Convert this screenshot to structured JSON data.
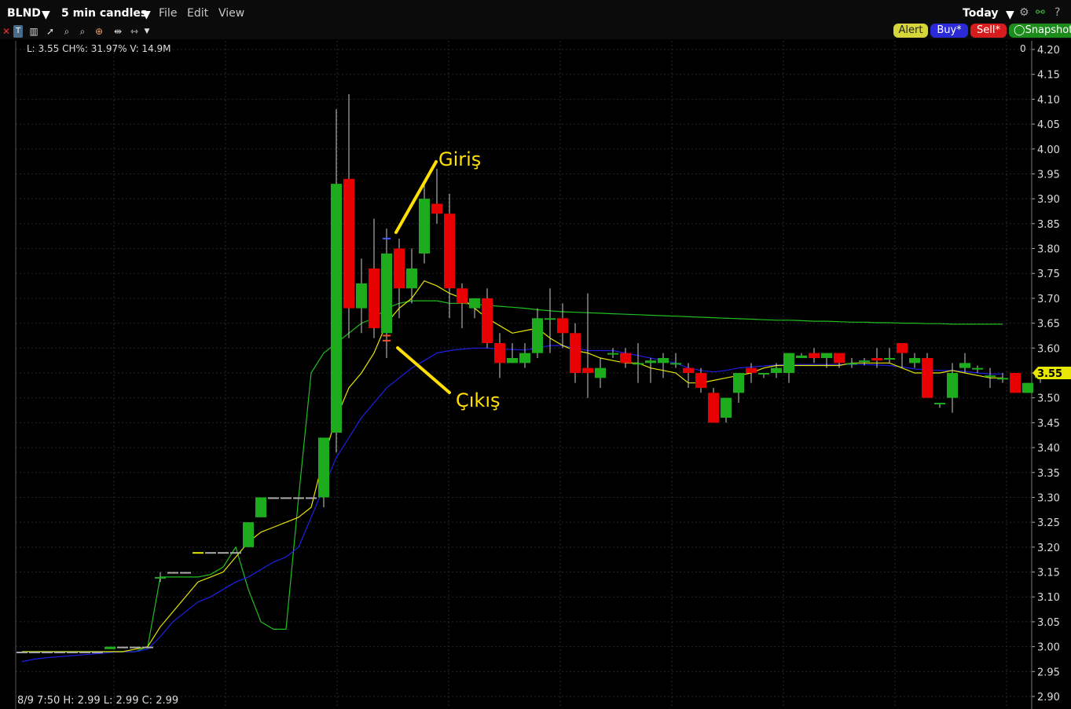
{
  "header": {
    "symbol": "BLND",
    "interval": "5 min candles",
    "menus": [
      "File",
      "Edit",
      "View"
    ],
    "period": "Today"
  },
  "toolbar": {
    "icons": [
      "close-icon",
      "bar-style-icon",
      "text-tool-icon",
      "candles-icon",
      "cursor-icon",
      "zoom-in-icon",
      "zoom-out-icon",
      "crosshair-icon",
      "pan-icon",
      "fit-icon",
      "more-icon"
    ],
    "alert_label": "Alert",
    "buy_label": "Buy*",
    "sell_label": "Sell*",
    "snapshot_label": "Snapshot"
  },
  "info_top": {
    "l": "L: 3.55",
    "ch": "CH%: 31.97%",
    "v": "V: 14.9M",
    "right_value": "0"
  },
  "info_bottom": {
    "date": "8/9 7:50",
    "h": "H: 2.99",
    "l": "L: 2.99",
    "c": "C: 2.99"
  },
  "colors": {
    "up": "#1cac1c",
    "down": "#e60000",
    "ma_fast": "#e6e600",
    "ma_mid": "#2020e6",
    "ma_slow": "#20c020",
    "annotation": "#ffe000",
    "price_tag": "#e6e600"
  },
  "chart_data": {
    "type": "candlestick",
    "y_ticks": [
      "4.20",
      "4.15",
      "4.10",
      "4.05",
      "4.00",
      "3.95",
      "3.90",
      "3.85",
      "3.80",
      "3.75",
      "3.70",
      "3.65",
      "3.60",
      "3.55",
      "3.50",
      "3.45",
      "3.40",
      "3.35",
      "3.30",
      "3.25",
      "3.20",
      "3.15",
      "3.10",
      "3.05",
      "3.00",
      "2.95",
      "2.90"
    ],
    "ylim": [
      2.9,
      4.2
    ],
    "last_price_label": "3.55",
    "candles": [
      {
        "o": 2.99,
        "h": 2.99,
        "l": 2.99,
        "c": 2.99
      },
      {
        "o": 2.99,
        "h": 2.99,
        "l": 2.99,
        "c": 2.99
      },
      {
        "o": 2.99,
        "h": 2.99,
        "l": 2.99,
        "c": 2.99
      },
      {
        "o": 2.99,
        "h": 2.99,
        "l": 2.99,
        "c": 2.99
      },
      {
        "o": 2.99,
        "h": 2.99,
        "l": 2.99,
        "c": 2.99
      },
      {
        "o": 2.99,
        "h": 2.99,
        "l": 2.99,
        "c": 2.99
      },
      {
        "o": 2.99,
        "h": 2.99,
        "l": 2.99,
        "c": 2.99
      },
      {
        "o": 2.995,
        "h": 3.0,
        "l": 2.995,
        "c": 3.0
      },
      {
        "o": 3.0,
        "h": 3.0,
        "l": 3.0,
        "c": 3.0
      },
      {
        "o": 3.0,
        "h": 3.0,
        "l": 3.0,
        "c": 3.0
      },
      {
        "o": 3.0,
        "h": 3.0,
        "l": 3.0,
        "c": 3.0
      },
      {
        "o": 3.14,
        "h": 3.15,
        "l": 3.13,
        "c": 3.14
      },
      {
        "o": 3.15,
        "h": 3.15,
        "l": 3.15,
        "c": 3.15
      },
      {
        "o": 3.15,
        "h": 3.15,
        "l": 3.15,
        "c": 3.15
      },
      {
        "o": 3.19,
        "h": 3.19,
        "l": 3.19,
        "c": 3.19
      },
      {
        "o": 3.19,
        "h": 3.19,
        "l": 3.19,
        "c": 3.19
      },
      {
        "o": 3.19,
        "h": 3.19,
        "l": 3.19,
        "c": 3.19
      },
      {
        "o": 3.19,
        "h": 3.19,
        "l": 3.19,
        "c": 3.19
      },
      {
        "o": 3.2,
        "h": 3.25,
        "l": 3.2,
        "c": 3.25
      },
      {
        "o": 3.26,
        "h": 3.3,
        "l": 3.26,
        "c": 3.3
      },
      {
        "o": 3.3,
        "h": 3.3,
        "l": 3.3,
        "c": 3.3
      },
      {
        "o": 3.3,
        "h": 3.3,
        "l": 3.3,
        "c": 3.3
      },
      {
        "o": 3.3,
        "h": 3.3,
        "l": 3.3,
        "c": 3.3
      },
      {
        "o": 3.3,
        "h": 3.3,
        "l": 3.3,
        "c": 3.3
      },
      {
        "o": 3.3,
        "h": 3.42,
        "l": 3.28,
        "c": 3.42
      },
      {
        "o": 3.43,
        "h": 4.08,
        "l": 3.39,
        "c": 3.93
      },
      {
        "o": 3.94,
        "h": 4.11,
        "l": 3.62,
        "c": 3.68
      },
      {
        "o": 3.68,
        "h": 3.78,
        "l": 3.63,
        "c": 3.73
      },
      {
        "o": 3.76,
        "h": 3.86,
        "l": 3.62,
        "c": 3.64
      },
      {
        "o": 3.63,
        "h": 3.84,
        "l": 3.58,
        "c": 3.79
      },
      {
        "o": 3.8,
        "h": 3.82,
        "l": 3.66,
        "c": 3.72
      },
      {
        "o": 3.72,
        "h": 3.8,
        "l": 3.69,
        "c": 3.76
      },
      {
        "o": 3.79,
        "h": 3.93,
        "l": 3.77,
        "c": 3.9
      },
      {
        "o": 3.89,
        "h": 3.96,
        "l": 3.85,
        "c": 3.87
      },
      {
        "o": 3.87,
        "h": 3.91,
        "l": 3.66,
        "c": 3.72
      },
      {
        "o": 3.72,
        "h": 3.73,
        "l": 3.64,
        "c": 3.69
      },
      {
        "o": 3.68,
        "h": 3.7,
        "l": 3.66,
        "c": 3.7
      },
      {
        "o": 3.7,
        "h": 3.72,
        "l": 3.6,
        "c": 3.61
      },
      {
        "o": 3.61,
        "h": 3.63,
        "l": 3.54,
        "c": 3.57
      },
      {
        "o": 3.57,
        "h": 3.61,
        "l": 3.57,
        "c": 3.58
      },
      {
        "o": 3.57,
        "h": 3.61,
        "l": 3.56,
        "c": 3.59
      },
      {
        "o": 3.59,
        "h": 3.68,
        "l": 3.58,
        "c": 3.66
      },
      {
        "o": 3.66,
        "h": 3.72,
        "l": 3.59,
        "c": 3.66
      },
      {
        "o": 3.66,
        "h": 3.69,
        "l": 3.6,
        "c": 3.63
      },
      {
        "o": 3.63,
        "h": 3.65,
        "l": 3.53,
        "c": 3.55
      },
      {
        "o": 3.56,
        "h": 3.71,
        "l": 3.5,
        "c": 3.55
      },
      {
        "o": 3.54,
        "h": 3.58,
        "l": 3.52,
        "c": 3.56
      },
      {
        "o": 3.59,
        "h": 3.6,
        "l": 3.58,
        "c": 3.59
      },
      {
        "o": 3.59,
        "h": 3.6,
        "l": 3.56,
        "c": 3.57
      },
      {
        "o": 3.57,
        "h": 3.61,
        "l": 3.53,
        "c": 3.57
      },
      {
        "o": 3.57,
        "h": 3.58,
        "l": 3.53,
        "c": 3.575
      },
      {
        "o": 3.57,
        "h": 3.59,
        "l": 3.54,
        "c": 3.58
      },
      {
        "o": 3.57,
        "h": 3.59,
        "l": 3.56,
        "c": 3.57
      },
      {
        "o": 3.56,
        "h": 3.57,
        "l": 3.52,
        "c": 3.55
      },
      {
        "o": 3.55,
        "h": 3.56,
        "l": 3.51,
        "c": 3.52
      },
      {
        "o": 3.51,
        "h": 3.52,
        "l": 3.45,
        "c": 3.45
      },
      {
        "o": 3.46,
        "h": 3.5,
        "l": 3.45,
        "c": 3.5
      },
      {
        "o": 3.51,
        "h": 3.55,
        "l": 3.49,
        "c": 3.55
      },
      {
        "o": 3.56,
        "h": 3.57,
        "l": 3.53,
        "c": 3.55
      },
      {
        "o": 3.55,
        "h": 3.55,
        "l": 3.54,
        "c": 3.55
      },
      {
        "o": 3.55,
        "h": 3.57,
        "l": 3.54,
        "c": 3.56
      },
      {
        "o": 3.55,
        "h": 3.59,
        "l": 3.53,
        "c": 3.59
      },
      {
        "o": 3.58,
        "h": 3.59,
        "l": 3.58,
        "c": 3.585
      },
      {
        "o": 3.59,
        "h": 3.6,
        "l": 3.57,
        "c": 3.58
      },
      {
        "o": 3.58,
        "h": 3.59,
        "l": 3.56,
        "c": 3.59
      },
      {
        "o": 3.59,
        "h": 3.59,
        "l": 3.56,
        "c": 3.57
      },
      {
        "o": 3.57,
        "h": 3.58,
        "l": 3.56,
        "c": 3.57
      },
      {
        "o": 3.575,
        "h": 3.58,
        "l": 3.565,
        "c": 3.575
      },
      {
        "o": 3.58,
        "h": 3.6,
        "l": 3.56,
        "c": 3.575
      },
      {
        "o": 3.58,
        "h": 3.6,
        "l": 3.57,
        "c": 3.58
      },
      {
        "o": 3.61,
        "h": 3.61,
        "l": 3.56,
        "c": 3.59
      },
      {
        "o": 3.57,
        "h": 3.59,
        "l": 3.56,
        "c": 3.58
      },
      {
        "o": 3.58,
        "h": 3.59,
        "l": 3.5,
        "c": 3.5
      },
      {
        "o": 3.49,
        "h": 3.49,
        "l": 3.48,
        "c": 3.49
      },
      {
        "o": 3.5,
        "h": 3.57,
        "l": 3.47,
        "c": 3.55
      },
      {
        "o": 3.56,
        "h": 3.59,
        "l": 3.55,
        "c": 3.57
      },
      {
        "o": 3.56,
        "h": 3.565,
        "l": 3.55,
        "c": 3.56
      },
      {
        "o": 3.545,
        "h": 3.56,
        "l": 3.52,
        "c": 3.545
      },
      {
        "o": 3.54,
        "h": 3.55,
        "l": 3.53,
        "c": 3.54
      },
      {
        "o": 3.55,
        "h": 3.55,
        "l": 3.51,
        "c": 3.51
      },
      {
        "o": 3.51,
        "h": 3.53,
        "l": 3.51,
        "c": 3.53
      },
      {
        "o": 3.54,
        "h": 3.55,
        "l": 3.53,
        "c": 3.55
      }
    ],
    "ma_fast": [
      2.99,
      2.99,
      2.99,
      2.99,
      2.99,
      2.99,
      2.99,
      2.99,
      2.99,
      2.995,
      3.0,
      3.04,
      3.07,
      3.1,
      3.13,
      3.14,
      3.15,
      3.18,
      3.21,
      3.23,
      3.24,
      3.25,
      3.26,
      3.28,
      3.38,
      3.46,
      3.52,
      3.55,
      3.59,
      3.65,
      3.68,
      3.7,
      3.735,
      3.725,
      3.71,
      3.7,
      3.68,
      3.66,
      3.645,
      3.63,
      3.635,
      3.64,
      3.62,
      3.605,
      3.595,
      3.59,
      3.58,
      3.575,
      3.57,
      3.57,
      3.56,
      3.555,
      3.55,
      3.53,
      3.53,
      3.535,
      3.54,
      3.545,
      3.55,
      3.56,
      3.565,
      3.565,
      3.565,
      3.565,
      3.565,
      3.565,
      3.57,
      3.57,
      3.57,
      3.57,
      3.56,
      3.55,
      3.55,
      3.55,
      3.555,
      3.55,
      3.545,
      3.54,
      3.54
    ],
    "ma_mid": [
      2.97,
      2.975,
      2.978,
      2.98,
      2.982,
      2.984,
      2.986,
      2.988,
      2.99,
      2.99,
      2.995,
      3.02,
      3.05,
      3.07,
      3.09,
      3.1,
      3.115,
      3.13,
      3.14,
      3.155,
      3.17,
      3.18,
      3.2,
      3.26,
      3.32,
      3.38,
      3.42,
      3.46,
      3.49,
      3.52,
      3.54,
      3.56,
      3.575,
      3.59,
      3.595,
      3.598,
      3.6,
      3.6,
      3.598,
      3.597,
      3.596,
      3.6,
      3.605,
      3.605,
      3.6,
      3.595,
      3.595,
      3.595,
      3.59,
      3.585,
      3.58,
      3.575,
      3.57,
      3.56,
      3.555,
      3.552,
      3.555,
      3.56,
      3.562,
      3.564,
      3.566,
      3.567,
      3.567,
      3.567,
      3.567,
      3.567,
      3.567,
      3.567,
      3.566,
      3.565,
      3.562,
      3.558,
      3.556,
      3.555,
      3.555,
      3.553,
      3.55,
      3.548,
      3.548
    ],
    "ma_slow": [
      2.99,
      2.99,
      2.99,
      2.99,
      2.99,
      2.99,
      2.99,
      2.99,
      2.99,
      2.99,
      3.0,
      3.14,
      3.14,
      3.14,
      3.14,
      3.145,
      3.16,
      3.2,
      3.115,
      3.05,
      3.035,
      3.035,
      3.3,
      3.55,
      3.59,
      3.61,
      3.63,
      3.65,
      3.66,
      3.68,
      3.69,
      3.695,
      3.695,
      3.695,
      3.69,
      3.69,
      3.688,
      3.686,
      3.684,
      3.682,
      3.68,
      3.677,
      3.675,
      3.673,
      3.672,
      3.671,
      3.67,
      3.669,
      3.668,
      3.667,
      3.666,
      3.665,
      3.664,
      3.663,
      3.662,
      3.661,
      3.66,
      3.659,
      3.658,
      3.657,
      3.656,
      3.656,
      3.655,
      3.654,
      3.654,
      3.653,
      3.652,
      3.652,
      3.651,
      3.651,
      3.65,
      3.65,
      3.649,
      3.649,
      3.648,
      3.648,
      3.648,
      3.648,
      3.648
    ],
    "annotations": [
      {
        "label": "Giriş"
      },
      {
        "label": "Çıkış"
      }
    ]
  }
}
